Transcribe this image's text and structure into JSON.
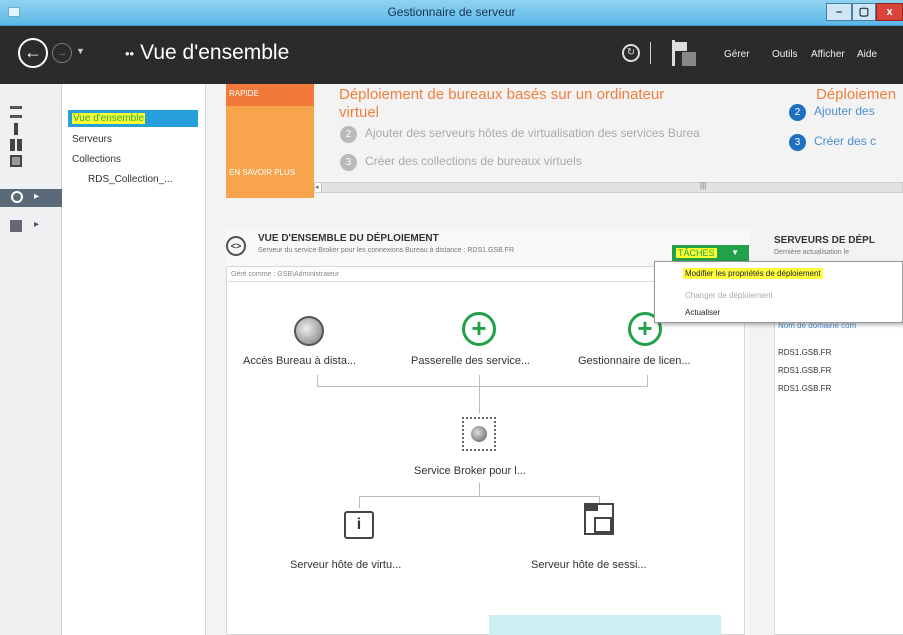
{
  "window": {
    "title": "Gestionnaire de serveur",
    "min_label": "–",
    "max_label": "▢",
    "close_label": "x"
  },
  "toolbar": {
    "back_glyph": "←",
    "forward_glyph": "→",
    "dropdown_glyph": "▼",
    "breadcrumb_dots": "••",
    "breadcrumb": "Vue d'ensemble",
    "refresh_glyph": "↻",
    "menu": {
      "gerer": "Gérer",
      "outils": "Outils",
      "afficher": "Afficher",
      "aide": "Aide"
    }
  },
  "rail": {
    "arrow1": "▸",
    "arrow2": "▸"
  },
  "sidebar": {
    "items": [
      {
        "label": "Vue d'ensemble"
      },
      {
        "label": "Serveurs"
      },
      {
        "label": "Collections"
      },
      {
        "label": "RDS_Collection_..."
      }
    ]
  },
  "quickstart": {
    "tile_top": "RAPIDE",
    "tile_learn": "EN SAVOIR PLUS",
    "heading_line1": "Déploiement de bureaux basés sur un ordinateur",
    "heading_line2": "virtuel",
    "heading_right": "Déploiemen",
    "steps_left": [
      {
        "num": "2",
        "text": "Ajouter des serveurs hôtes de virtualisation des services Burea"
      },
      {
        "num": "3",
        "text": "Créer des collections de bureaux virtuels"
      }
    ],
    "steps_right": [
      {
        "num": "2",
        "text": "Ajouter des"
      },
      {
        "num": "3",
        "text": "Créer des c"
      }
    ],
    "scroll_left_glyph": "◂",
    "scroll_mid_glyph": "|||"
  },
  "deployment": {
    "title": "VUE D'ENSEMBLE DU DÉPLOIEMENT",
    "subtitle": "Serveur du service Broker pour les connexions Bureau à distance : RDS1.GSB.FR",
    "icon_glyph": "<>",
    "tasks_button": "TÂCHES",
    "tasks_arrow": "▼",
    "managed_as": "Géré comme : GSB\\Administrateur",
    "nodes": {
      "rd_web": "Accès Bureau à dista...",
      "gateway": "Passerelle des service...",
      "licensing": "Gestionnaire de licen...",
      "broker": "Service Broker pour l...",
      "virt_host": "Serveur hôte de virtu...",
      "session_host": "Serveur hôte de sessi..."
    },
    "plus_glyph": "+",
    "info_glyph": "i"
  },
  "servers": {
    "title": "SERVEURS DE DÉPL",
    "subtitle": "Dernière actualisation le",
    "column_header": "Nom de domaine com",
    "rows": [
      "RDS1.GSB.FR",
      "RDS1.GSB.FR",
      "RDS1.GSB.FR"
    ]
  },
  "tasks_menu": {
    "items": [
      {
        "label": "Modifier les propriétés de déploiement",
        "enabled": true,
        "highlighted": true
      },
      {
        "label": "Changer de déploiement",
        "enabled": false
      },
      {
        "label": "Actualiser",
        "enabled": true
      }
    ]
  },
  "colors": {
    "titlebar": "#5bb8e6",
    "toolbar": "#2b2b2b",
    "accent_blue": "#26a0da",
    "task_green": "#22a04a",
    "highlight_yellow": "#ffff30",
    "orange": "#f2793a"
  }
}
